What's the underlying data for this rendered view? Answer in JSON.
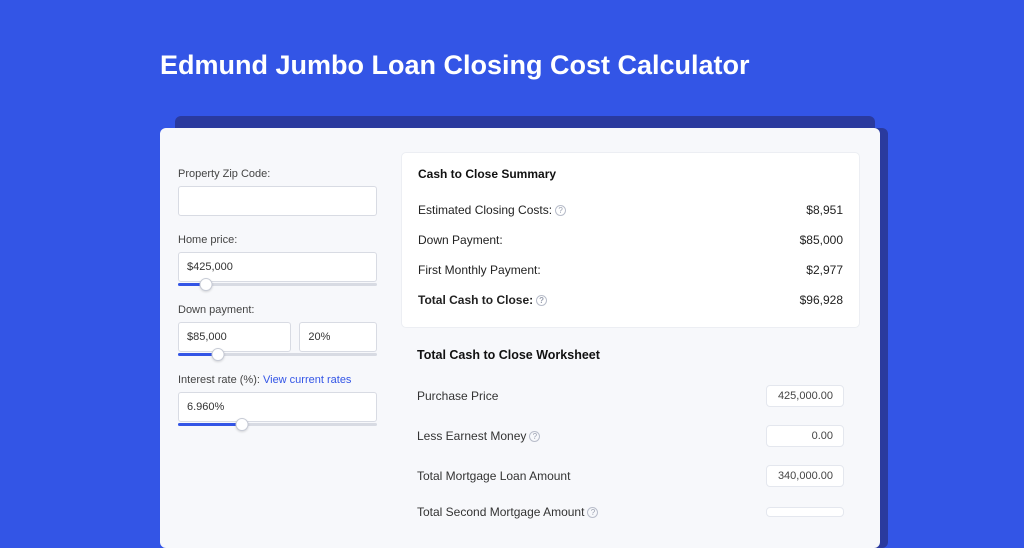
{
  "title": "Edmund Jumbo Loan Closing Cost Calculator",
  "colors": {
    "accent": "#3355e6"
  },
  "left": {
    "zip_label": "Property Zip Code:",
    "zip_value": "",
    "home_price_label": "Home price:",
    "home_price_value": "$425,000",
    "home_price_slider_pct": 14,
    "down_payment_label": "Down payment:",
    "down_payment_amount": "$85,000",
    "down_payment_pct": "20%",
    "down_payment_slider_pct": 20,
    "interest_label_prefix": "Interest rate (%): ",
    "interest_link": "View current rates",
    "interest_value": "6.960%",
    "interest_slider_pct": 32
  },
  "summary": {
    "heading": "Cash to Close Summary",
    "rows": [
      {
        "label": "Estimated Closing Costs:",
        "help": true,
        "value": "$8,951",
        "bold": false
      },
      {
        "label": "Down Payment:",
        "help": false,
        "value": "$85,000",
        "bold": false
      },
      {
        "label": "First Monthly Payment:",
        "help": false,
        "value": "$2,977",
        "bold": false
      },
      {
        "label": "Total Cash to Close:",
        "help": true,
        "value": "$96,928",
        "bold": true
      }
    ]
  },
  "worksheet": {
    "heading": "Total Cash to Close Worksheet",
    "rows": [
      {
        "label": "Purchase Price",
        "help": false,
        "value": "425,000.00"
      },
      {
        "label": "Less Earnest Money",
        "help": true,
        "value": "0.00"
      },
      {
        "label": "Total Mortgage Loan Amount",
        "help": false,
        "value": "340,000.00"
      },
      {
        "label": "Total Second Mortgage Amount",
        "help": true,
        "value": ""
      }
    ]
  }
}
